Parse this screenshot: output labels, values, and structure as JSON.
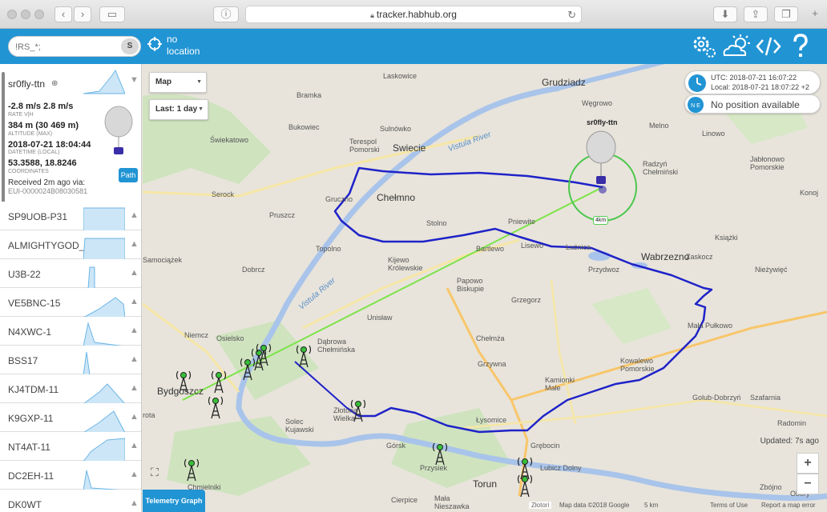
{
  "browser": {
    "url": "tracker.habhub.org"
  },
  "header": {
    "search_placeholder": "!RS_*;",
    "search_btn": "S",
    "location_line1": "no",
    "location_line2": "location",
    "icons": [
      "settings-icon",
      "weather-icon",
      "code-icon",
      "help-icon"
    ]
  },
  "sidebar": {
    "main_vehicle": {
      "name": "sr0fly-ttn",
      "rate": "-2.8 m/s 2.8 m/s",
      "rate_label": "RATE V|H",
      "altitude": "384 m (30 469 m)",
      "altitude_label": "ALTITUDE (MAX)",
      "datetime": "2018-07-21 18:04:44",
      "datetime_label": "DATETIME (LOCAL)",
      "coords": "53.3588, 18.8246",
      "coords_label": "COORDINATES",
      "received": "Received 2m ago via:",
      "receiver": "EUI-0000024B08030581",
      "path_btn": "Path"
    },
    "vehicles": [
      {
        "name": "SP9UOB-P31"
      },
      {
        "name": "ALMIGHTYGOD_chase"
      },
      {
        "name": "U3B-22"
      },
      {
        "name": "VE5BNC-15"
      },
      {
        "name": "N4XWC-1"
      },
      {
        "name": "BSS17"
      },
      {
        "name": "KJ4TDM-11"
      },
      {
        "name": "K9GXP-11"
      },
      {
        "name": "NT4AT-11"
      },
      {
        "name": "DC2EH-11"
      },
      {
        "name": "DK0WT"
      }
    ]
  },
  "map": {
    "type_select": "Map",
    "period_select": "Last: 1 day",
    "utc": "UTC: 2018-07-21 16:07:22",
    "local": "Local: 2018-07-21 18:07:22 +2",
    "position_status": "No position available",
    "updated": "Updated: 7s ago",
    "zoom_in": "+",
    "zoom_out": "−",
    "telemetry_btn": "Telemetry Graph",
    "balloon_label": "sr0fly-ttn",
    "range_label": "4km",
    "attribution_data": "Map data ©2018 Google",
    "scale": "5 km",
    "terms": "Terms of Use",
    "report": "Report a map error",
    "places": {
      "laskowice": "Laskowice",
      "grudziadz": "Grudziadz",
      "bramka": "Bramka",
      "wegrowo": "Węgrowo",
      "bukowiec": "Bukowiec",
      "swiekatowo": "Świekatowo",
      "sulnowko": "Sulnówko",
      "terespol": "Terespol\nPomorski",
      "swiecie": "Swiecie",
      "vistula1": "Vistula River",
      "melno": "Melno",
      "radzyn": "Radzyń\nChełmiński",
      "linowo": "Linowo",
      "jablonowo": "Jabłonowo\nPomorskie",
      "serock": "Serock",
      "gruczno": "Gruczno",
      "chelmno": "Chełmno",
      "pruszcz": "Pruszcz",
      "stolno": "Stolno",
      "pniewite": "Pniewite",
      "lisewo": "Lisewo",
      "ksiazki": "Książki",
      "konojady": "Konoj",
      "zaskocz": "Zaskocz",
      "topolno": "Topolno",
      "bartlewo": "Bartlewo",
      "kijewo": "Kijewo\nKrólewskie",
      "luznica": "Łuźnica",
      "wabrzezno": "Wabrzezno",
      "samociazek": "Samociążek",
      "dobrcz": "Dobrcz",
      "vistula2": "Vistula River",
      "papowo": "Papowo\nBiskupie",
      "przydwoz": "Przydwoz",
      "niezywiec": "Nieżywięć",
      "grzegorz": "Grzegorz",
      "unislaw": "Unisław",
      "niemcz": "Niemcz",
      "osielsko": "Osielsko",
      "dabrowa": "Dąbrowa\nChełmińska",
      "chelmza": "Chełmża",
      "mala_pulkowo": "Mała Pułkowo",
      "grzywna": "Grzywna",
      "kowalewo": "Kowalewo\nPomorskie",
      "bydgoszcz": "Bydgoszcz",
      "kamionki": "Kamionki\nMałe",
      "golub": "Golub-Dobrzyń",
      "szafarnia": "Szafarnia",
      "zlotoria": "Złotoria\nWielka",
      "solec": "Solec\nKujawski",
      "lysomice": "Łysomice",
      "radomin": "Radomin",
      "grebocin": "Grębocin",
      "gorsk": "Górsk",
      "przysiek": "Przysiek",
      "lubicz": "Lubicz Dolny",
      "torun": "Torun",
      "chmielniki": "Chmielniki",
      "cierpice": "Cierpice",
      "mala_nieszawka": "Mała\nNieszawka",
      "zlotoria2": "Złotori",
      "zbojno": "Zbójno",
      "obory": "Obory",
      "otowo": "rota"
    }
  },
  "colors": {
    "header_bg": "#2194d4",
    "flight_path": "#1f23c8",
    "chase_line": "#7de34a",
    "range_circle": "#4cc74c"
  }
}
